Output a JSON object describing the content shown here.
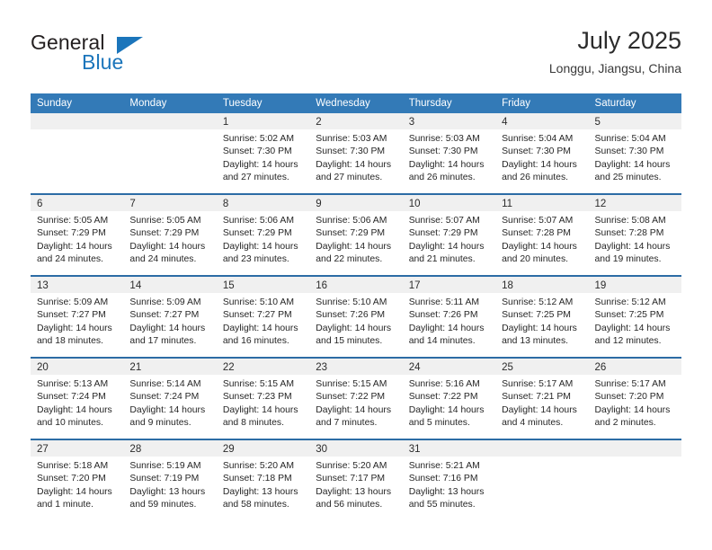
{
  "brand": {
    "word1": "General",
    "word2": "Blue",
    "accent_color": "#1b75bb"
  },
  "header": {
    "title": "July 2025",
    "subtitle": "Longgu, Jiangsu, China"
  },
  "calendar": {
    "header_bg": "#337ab7",
    "row_divider": "#2c6ca5",
    "datestrip_bg": "#f0f0f0",
    "weekday_headers": [
      "Sunday",
      "Monday",
      "Tuesday",
      "Wednesday",
      "Thursday",
      "Friday",
      "Saturday"
    ],
    "weeks": [
      [
        {
          "day": "",
          "sunrise": "",
          "sunset": "",
          "daylight1": "",
          "daylight2": ""
        },
        {
          "day": "",
          "sunrise": "",
          "sunset": "",
          "daylight1": "",
          "daylight2": ""
        },
        {
          "day": "1",
          "sunrise": "Sunrise: 5:02 AM",
          "sunset": "Sunset: 7:30 PM",
          "daylight1": "Daylight: 14 hours",
          "daylight2": "and 27 minutes."
        },
        {
          "day": "2",
          "sunrise": "Sunrise: 5:03 AM",
          "sunset": "Sunset: 7:30 PM",
          "daylight1": "Daylight: 14 hours",
          "daylight2": "and 27 minutes."
        },
        {
          "day": "3",
          "sunrise": "Sunrise: 5:03 AM",
          "sunset": "Sunset: 7:30 PM",
          "daylight1": "Daylight: 14 hours",
          "daylight2": "and 26 minutes."
        },
        {
          "day": "4",
          "sunrise": "Sunrise: 5:04 AM",
          "sunset": "Sunset: 7:30 PM",
          "daylight1": "Daylight: 14 hours",
          "daylight2": "and 26 minutes."
        },
        {
          "day": "5",
          "sunrise": "Sunrise: 5:04 AM",
          "sunset": "Sunset: 7:30 PM",
          "daylight1": "Daylight: 14 hours",
          "daylight2": "and 25 minutes."
        }
      ],
      [
        {
          "day": "6",
          "sunrise": "Sunrise: 5:05 AM",
          "sunset": "Sunset: 7:29 PM",
          "daylight1": "Daylight: 14 hours",
          "daylight2": "and 24 minutes."
        },
        {
          "day": "7",
          "sunrise": "Sunrise: 5:05 AM",
          "sunset": "Sunset: 7:29 PM",
          "daylight1": "Daylight: 14 hours",
          "daylight2": "and 24 minutes."
        },
        {
          "day": "8",
          "sunrise": "Sunrise: 5:06 AM",
          "sunset": "Sunset: 7:29 PM",
          "daylight1": "Daylight: 14 hours",
          "daylight2": "and 23 minutes."
        },
        {
          "day": "9",
          "sunrise": "Sunrise: 5:06 AM",
          "sunset": "Sunset: 7:29 PM",
          "daylight1": "Daylight: 14 hours",
          "daylight2": "and 22 minutes."
        },
        {
          "day": "10",
          "sunrise": "Sunrise: 5:07 AM",
          "sunset": "Sunset: 7:29 PM",
          "daylight1": "Daylight: 14 hours",
          "daylight2": "and 21 minutes."
        },
        {
          "day": "11",
          "sunrise": "Sunrise: 5:07 AM",
          "sunset": "Sunset: 7:28 PM",
          "daylight1": "Daylight: 14 hours",
          "daylight2": "and 20 minutes."
        },
        {
          "day": "12",
          "sunrise": "Sunrise: 5:08 AM",
          "sunset": "Sunset: 7:28 PM",
          "daylight1": "Daylight: 14 hours",
          "daylight2": "and 19 minutes."
        }
      ],
      [
        {
          "day": "13",
          "sunrise": "Sunrise: 5:09 AM",
          "sunset": "Sunset: 7:27 PM",
          "daylight1": "Daylight: 14 hours",
          "daylight2": "and 18 minutes."
        },
        {
          "day": "14",
          "sunrise": "Sunrise: 5:09 AM",
          "sunset": "Sunset: 7:27 PM",
          "daylight1": "Daylight: 14 hours",
          "daylight2": "and 17 minutes."
        },
        {
          "day": "15",
          "sunrise": "Sunrise: 5:10 AM",
          "sunset": "Sunset: 7:27 PM",
          "daylight1": "Daylight: 14 hours",
          "daylight2": "and 16 minutes."
        },
        {
          "day": "16",
          "sunrise": "Sunrise: 5:10 AM",
          "sunset": "Sunset: 7:26 PM",
          "daylight1": "Daylight: 14 hours",
          "daylight2": "and 15 minutes."
        },
        {
          "day": "17",
          "sunrise": "Sunrise: 5:11 AM",
          "sunset": "Sunset: 7:26 PM",
          "daylight1": "Daylight: 14 hours",
          "daylight2": "and 14 minutes."
        },
        {
          "day": "18",
          "sunrise": "Sunrise: 5:12 AM",
          "sunset": "Sunset: 7:25 PM",
          "daylight1": "Daylight: 14 hours",
          "daylight2": "and 13 minutes."
        },
        {
          "day": "19",
          "sunrise": "Sunrise: 5:12 AM",
          "sunset": "Sunset: 7:25 PM",
          "daylight1": "Daylight: 14 hours",
          "daylight2": "and 12 minutes."
        }
      ],
      [
        {
          "day": "20",
          "sunrise": "Sunrise: 5:13 AM",
          "sunset": "Sunset: 7:24 PM",
          "daylight1": "Daylight: 14 hours",
          "daylight2": "and 10 minutes."
        },
        {
          "day": "21",
          "sunrise": "Sunrise: 5:14 AM",
          "sunset": "Sunset: 7:24 PM",
          "daylight1": "Daylight: 14 hours",
          "daylight2": "and 9 minutes."
        },
        {
          "day": "22",
          "sunrise": "Sunrise: 5:15 AM",
          "sunset": "Sunset: 7:23 PM",
          "daylight1": "Daylight: 14 hours",
          "daylight2": "and 8 minutes."
        },
        {
          "day": "23",
          "sunrise": "Sunrise: 5:15 AM",
          "sunset": "Sunset: 7:22 PM",
          "daylight1": "Daylight: 14 hours",
          "daylight2": "and 7 minutes."
        },
        {
          "day": "24",
          "sunrise": "Sunrise: 5:16 AM",
          "sunset": "Sunset: 7:22 PM",
          "daylight1": "Daylight: 14 hours",
          "daylight2": "and 5 minutes."
        },
        {
          "day": "25",
          "sunrise": "Sunrise: 5:17 AM",
          "sunset": "Sunset: 7:21 PM",
          "daylight1": "Daylight: 14 hours",
          "daylight2": "and 4 minutes."
        },
        {
          "day": "26",
          "sunrise": "Sunrise: 5:17 AM",
          "sunset": "Sunset: 7:20 PM",
          "daylight1": "Daylight: 14 hours",
          "daylight2": "and 2 minutes."
        }
      ],
      [
        {
          "day": "27",
          "sunrise": "Sunrise: 5:18 AM",
          "sunset": "Sunset: 7:20 PM",
          "daylight1": "Daylight: 14 hours",
          "daylight2": "and 1 minute."
        },
        {
          "day": "28",
          "sunrise": "Sunrise: 5:19 AM",
          "sunset": "Sunset: 7:19 PM",
          "daylight1": "Daylight: 13 hours",
          "daylight2": "and 59 minutes."
        },
        {
          "day": "29",
          "sunrise": "Sunrise: 5:20 AM",
          "sunset": "Sunset: 7:18 PM",
          "daylight1": "Daylight: 13 hours",
          "daylight2": "and 58 minutes."
        },
        {
          "day": "30",
          "sunrise": "Sunrise: 5:20 AM",
          "sunset": "Sunset: 7:17 PM",
          "daylight1": "Daylight: 13 hours",
          "daylight2": "and 56 minutes."
        },
        {
          "day": "31",
          "sunrise": "Sunrise: 5:21 AM",
          "sunset": "Sunset: 7:16 PM",
          "daylight1": "Daylight: 13 hours",
          "daylight2": "and 55 minutes."
        },
        {
          "day": "",
          "sunrise": "",
          "sunset": "",
          "daylight1": "",
          "daylight2": ""
        },
        {
          "day": "",
          "sunrise": "",
          "sunset": "",
          "daylight1": "",
          "daylight2": ""
        }
      ]
    ]
  }
}
